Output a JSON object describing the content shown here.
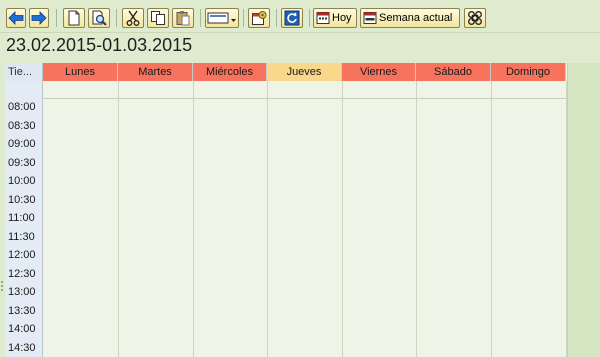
{
  "toolbar": {
    "buttons": [
      {
        "name": "back-button",
        "icon": "arrow-left-icon"
      },
      {
        "name": "forward-button",
        "icon": "arrow-right-icon"
      },
      {
        "name": "new-document-button",
        "icon": "new-document-icon"
      },
      {
        "name": "find-button",
        "icon": "magnifier-document-icon"
      },
      {
        "name": "cut-button",
        "icon": "scissors-icon"
      },
      {
        "name": "copy-button",
        "icon": "copy-icon"
      },
      {
        "name": "paste-button",
        "icon": "paste-icon"
      },
      {
        "name": "view-dropdown-button",
        "icon": "view-dropdown-icon"
      },
      {
        "name": "settings-button",
        "icon": "calendar-settings-icon"
      },
      {
        "name": "refresh-button",
        "icon": "refresh-icon"
      }
    ],
    "today_label": "Hoy",
    "current_week_label": "Semana actual",
    "extra_icon": "command-icon"
  },
  "date_range": "23.02.2015-01.03.2015",
  "calendar": {
    "time_header": "Tie...",
    "days": [
      {
        "label": "Lunes",
        "today": false
      },
      {
        "label": "Martes",
        "today": false
      },
      {
        "label": "Miércoles",
        "today": false
      },
      {
        "label": "Jueves",
        "today": true
      },
      {
        "label": "Viernes",
        "today": false
      },
      {
        "label": "Sábado",
        "today": false
      },
      {
        "label": "Domingo",
        "today": false
      }
    ],
    "time_slots": [
      "08:00",
      "08:30",
      "09:00",
      "09:30",
      "10:00",
      "10:30",
      "11:00",
      "11:30",
      "12:00",
      "12:30",
      "13:00",
      "13:30",
      "14:00",
      "14:30"
    ],
    "colors": {
      "day_header": "#f7735e",
      "today_header": "#f9d88b",
      "time_column": "#e3ebf4",
      "grid_background": "#eff4e7"
    }
  }
}
